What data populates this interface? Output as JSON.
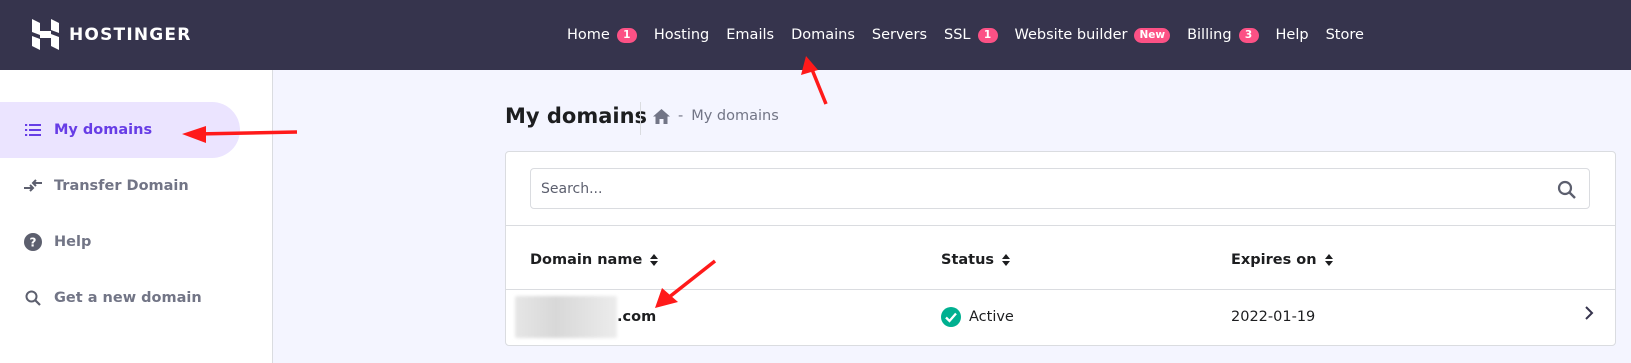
{
  "brand": {
    "name": "HOSTINGER"
  },
  "nav": [
    {
      "label": "Home",
      "badge": "1"
    },
    {
      "label": "Hosting",
      "badge": ""
    },
    {
      "label": "Emails",
      "badge": ""
    },
    {
      "label": "Domains",
      "badge": ""
    },
    {
      "label": "Servers",
      "badge": ""
    },
    {
      "label": "SSL",
      "badge": "1"
    },
    {
      "label": "Website builder",
      "badge": "New"
    },
    {
      "label": "Billing",
      "badge": "3"
    },
    {
      "label": "Help",
      "badge": ""
    },
    {
      "label": "Store",
      "badge": ""
    }
  ],
  "sidebar": {
    "items": [
      {
        "label": "My domains",
        "icon": "list-icon",
        "active": true
      },
      {
        "label": "Transfer Domain",
        "icon": "transfer-icon",
        "active": false
      },
      {
        "label": "Help",
        "icon": "help-circle-icon",
        "active": false
      },
      {
        "label": "Get a new domain",
        "icon": "search-icon",
        "active": false
      }
    ]
  },
  "main": {
    "title": "My domains",
    "breadcrumb": {
      "separator": "-",
      "current": "My domains"
    },
    "search": {
      "placeholder": "Search...",
      "value": ""
    },
    "table": {
      "columns": [
        "Domain name",
        "Status",
        "Expires on"
      ],
      "rows": [
        {
          "domain_suffix": ".com",
          "status": "Active",
          "expires": "2022-01-19"
        }
      ]
    }
  },
  "colors": {
    "topbar": "#36344d",
    "accent": "#673de6",
    "badge": "#fc5185",
    "active_status": "#00b090",
    "annotation_arrow": "#ff0000"
  }
}
